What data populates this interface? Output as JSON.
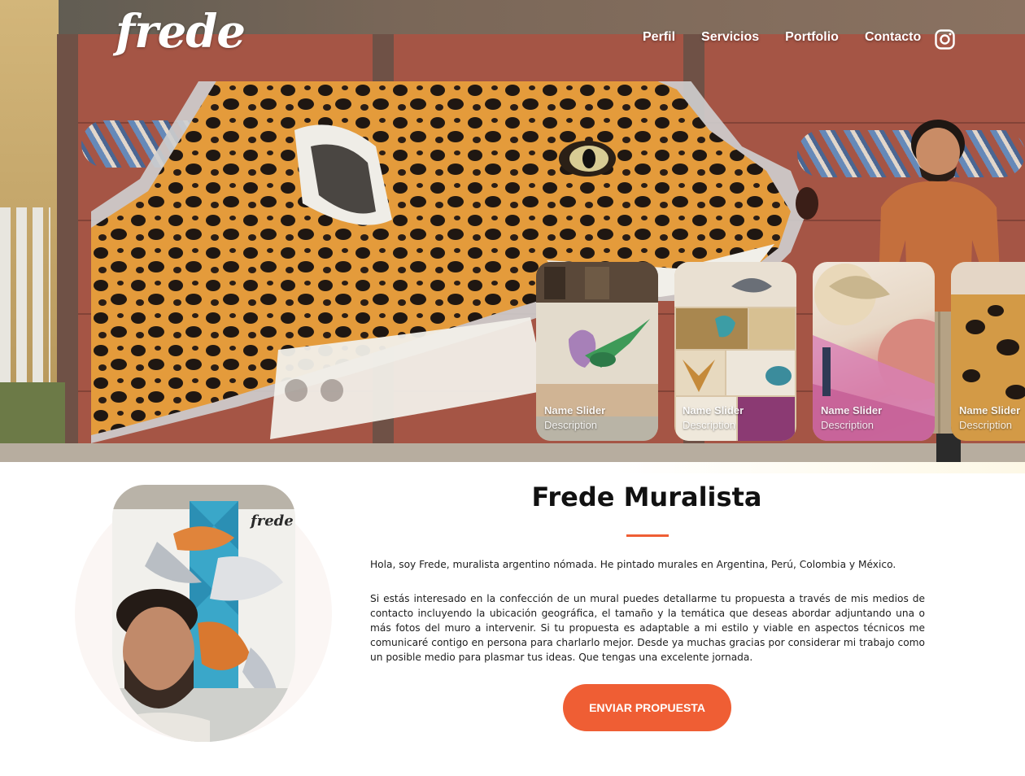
{
  "brand": {
    "logo_text": "frede"
  },
  "nav": {
    "items": [
      {
        "label": "Perfil"
      },
      {
        "label": "Servicios"
      },
      {
        "label": "Portfolio"
      },
      {
        "label": "Contacto"
      }
    ],
    "social_icon": "instagram-icon"
  },
  "slider": {
    "cards": [
      {
        "name": "Name Slider",
        "description": "Description",
        "image": "hummingbird-mural"
      },
      {
        "name": "Name Slider",
        "description": "Description",
        "image": "birds-butterfly-collage"
      },
      {
        "name": "Name Slider",
        "description": "Description",
        "image": "pink-geometric-wall"
      },
      {
        "name": "Name Slider",
        "description": "Description",
        "image": "jaguar-closeup"
      }
    ]
  },
  "about": {
    "title": "Frede Muralista",
    "intro": "Hola, soy Frede, muralista argentino nómada. He pintado murales en Argentina, Perú, Colombia y México.",
    "body": "Si estás interesado en la confección de un mural puedes detallarme tu propuesta a través de mis medios de contacto incluyendo la ubicación geográfica, el tamaño y la temática que deseas abordar adjuntando una o más fotos del muro a intervenir. Si tu propuesta es adaptable a mi estilo y viable en aspectos técnicos me comunicaré contigo en persona para charlarlo mejor. Desde ya muchas gracias por considerar mi trabajo como un posible medio para plasmar tus ideas. Que tengas una excelente jornada.",
    "cta_label": "ENVIAR PROPUESTA",
    "portrait_sign": "frede"
  },
  "colors": {
    "accent": "#ef5e34",
    "text": "#111111"
  }
}
